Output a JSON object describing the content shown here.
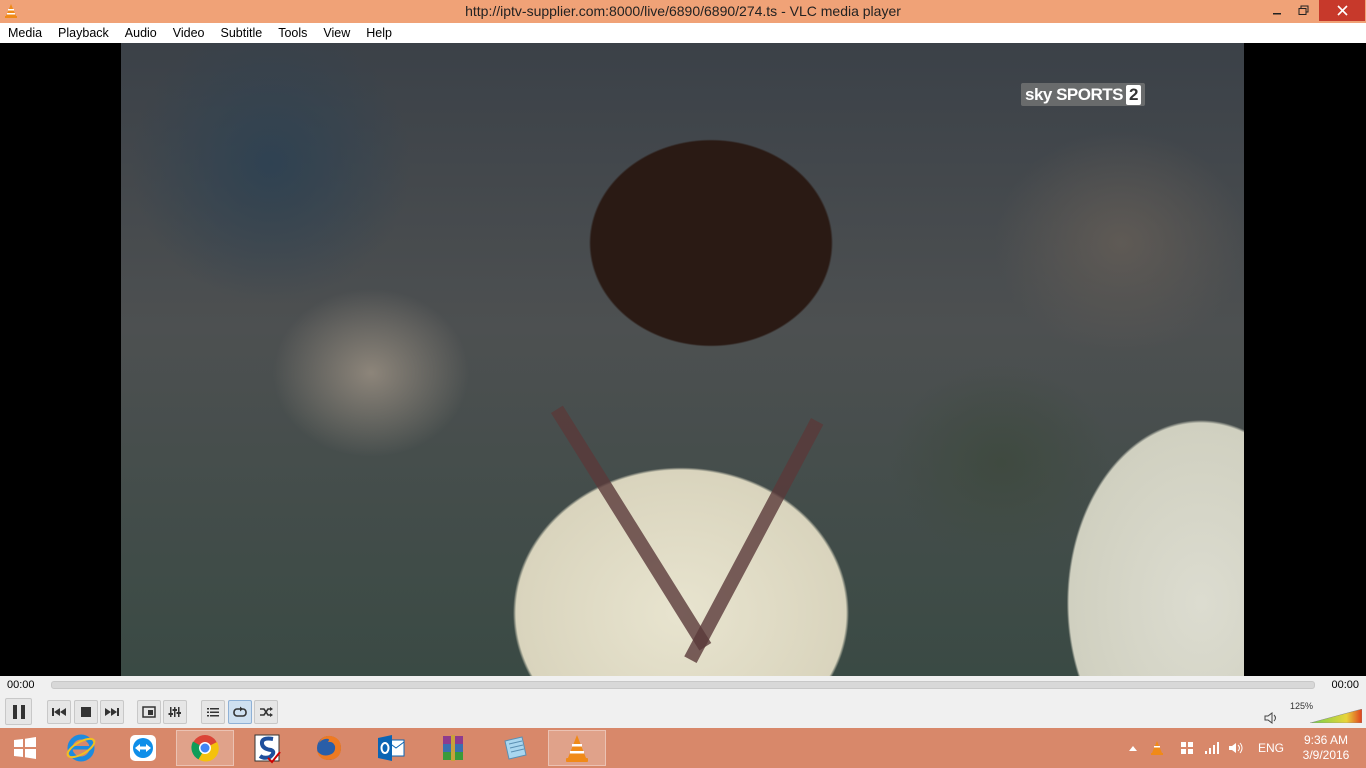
{
  "window": {
    "title": "http://iptv-supplier.com:8000/live/6890/6890/274.ts - VLC media player"
  },
  "menu": [
    "Media",
    "Playback",
    "Audio",
    "Video",
    "Subtitle",
    "Tools",
    "View",
    "Help"
  ],
  "video": {
    "channel_logo_text": "sky SPORTS",
    "channel_logo_number": "2"
  },
  "seek": {
    "elapsed": "00:00",
    "total": "00:00",
    "progress": 0
  },
  "controls": {
    "buttons": [
      "pause-icon",
      "previous-icon",
      "stop-icon",
      "next-icon",
      "fullscreen-icon",
      "extended-settings-icon",
      "playlist-icon",
      "loop-icon",
      "shuffle-icon"
    ],
    "volume_percent": "125%",
    "volume_level": 1.25
  },
  "taskbar": {
    "apps": [
      "windows-start-icon",
      "internet-explorer-icon",
      "teamviewer-icon",
      "chrome-icon",
      "app-s-icon",
      "firefox-icon",
      "outlook-icon",
      "winrar-icon",
      "notepad-icon",
      "vlc-icon"
    ],
    "language": "ENG",
    "time": "9:36 AM",
    "date": "3/9/2016"
  },
  "colors": {
    "titlebar": "#f0a277",
    "taskbar": "#d8886a",
    "close_button": "#c7392b"
  }
}
